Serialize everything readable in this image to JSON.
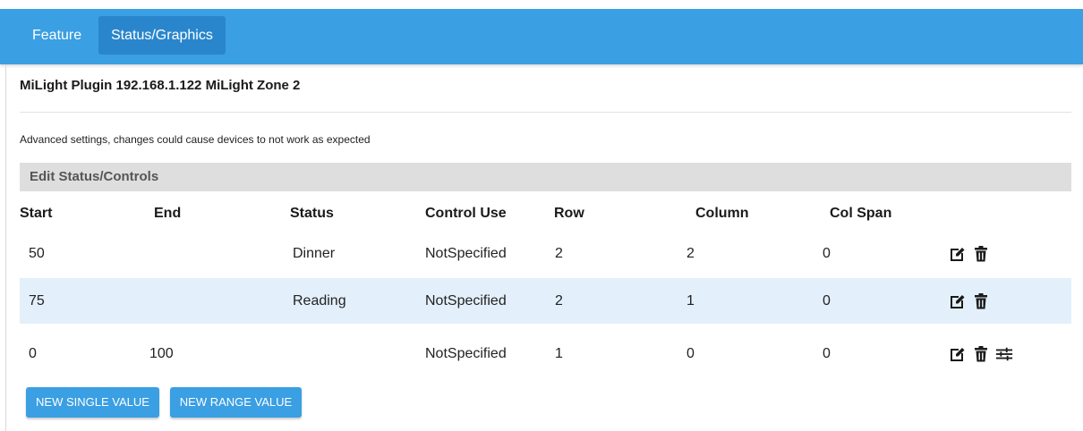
{
  "tabs": [
    {
      "label": "Feature"
    },
    {
      "label": "Status/Graphics"
    }
  ],
  "page": {
    "title": "MiLight Plugin 192.168.1.122 MiLight Zone 2",
    "warning": "Advanced settings, changes could cause devices to not work as expected",
    "section_header": "Edit Status/Controls"
  },
  "table": {
    "columns": [
      "Start",
      "End",
      "Status",
      "Control Use",
      "Row",
      "Column",
      "Col Span"
    ],
    "rows": [
      {
        "start": "50",
        "end": "",
        "status": "Dinner",
        "control_use": "NotSpecified",
        "row": "2",
        "column": "2",
        "col_span": "0",
        "actions": [
          "edit-icon",
          "trash-icon"
        ]
      },
      {
        "start": "75",
        "end": "",
        "status": "Reading",
        "control_use": "NotSpecified",
        "row": "2",
        "column": "1",
        "col_span": "0",
        "actions": [
          "edit-icon",
          "trash-icon"
        ]
      },
      {
        "start": "0",
        "end": "100",
        "status": "",
        "control_use": "NotSpecified",
        "row": "1",
        "column": "0",
        "col_span": "0",
        "actions": [
          "edit-icon",
          "trash-icon",
          "sliders-icon"
        ]
      }
    ]
  },
  "buttons": {
    "new_single": "NEW SINGLE VALUE",
    "new_range": "NEW RANGE VALUE"
  },
  "colors": {
    "primary": "#3a9fe3",
    "active_tab": "#2a86cc",
    "row_highlight": "#e3f0fb",
    "section_header_bg": "#dedede"
  }
}
